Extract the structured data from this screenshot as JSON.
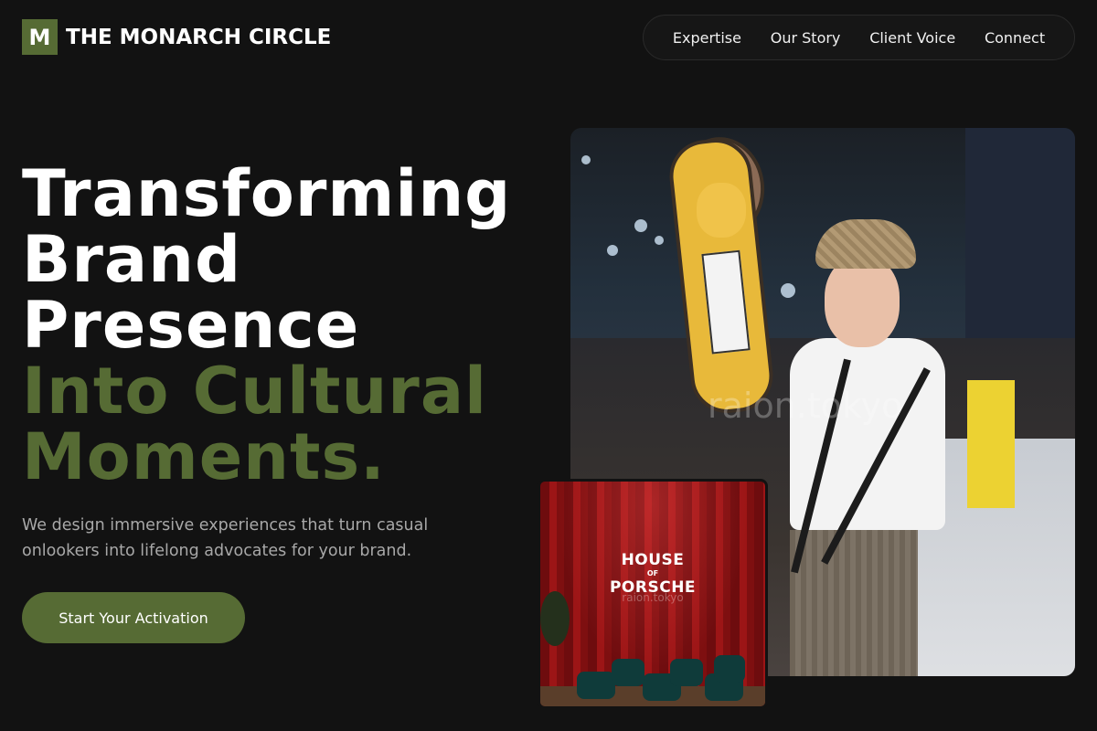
{
  "brand": {
    "mark": "M",
    "name": "THE MONARCH CIRCLE"
  },
  "nav": {
    "items": [
      "Expertise",
      "Our Story",
      "Client Voice",
      "Connect"
    ]
  },
  "hero": {
    "headline_white": [
      "Transforming",
      "Brand",
      "Presence"
    ],
    "headline_green": [
      "Into Cultural",
      "Moments."
    ],
    "subtitle": "We design immersive experiences that turn casual onlookers into lifelong advocates for your brand.",
    "cta_label": "Start Your Activation"
  },
  "images": {
    "main_watermark": "raion.tokyo",
    "secondary_sign": {
      "line1": "HOUSE",
      "line2": "OF",
      "line3": "PORSCHE"
    },
    "secondary_watermark": "raion.tokyo"
  },
  "colors": {
    "background": "#121212",
    "accent": "#566b34",
    "text": "#ffffff",
    "muted": "#a8a8a8"
  }
}
